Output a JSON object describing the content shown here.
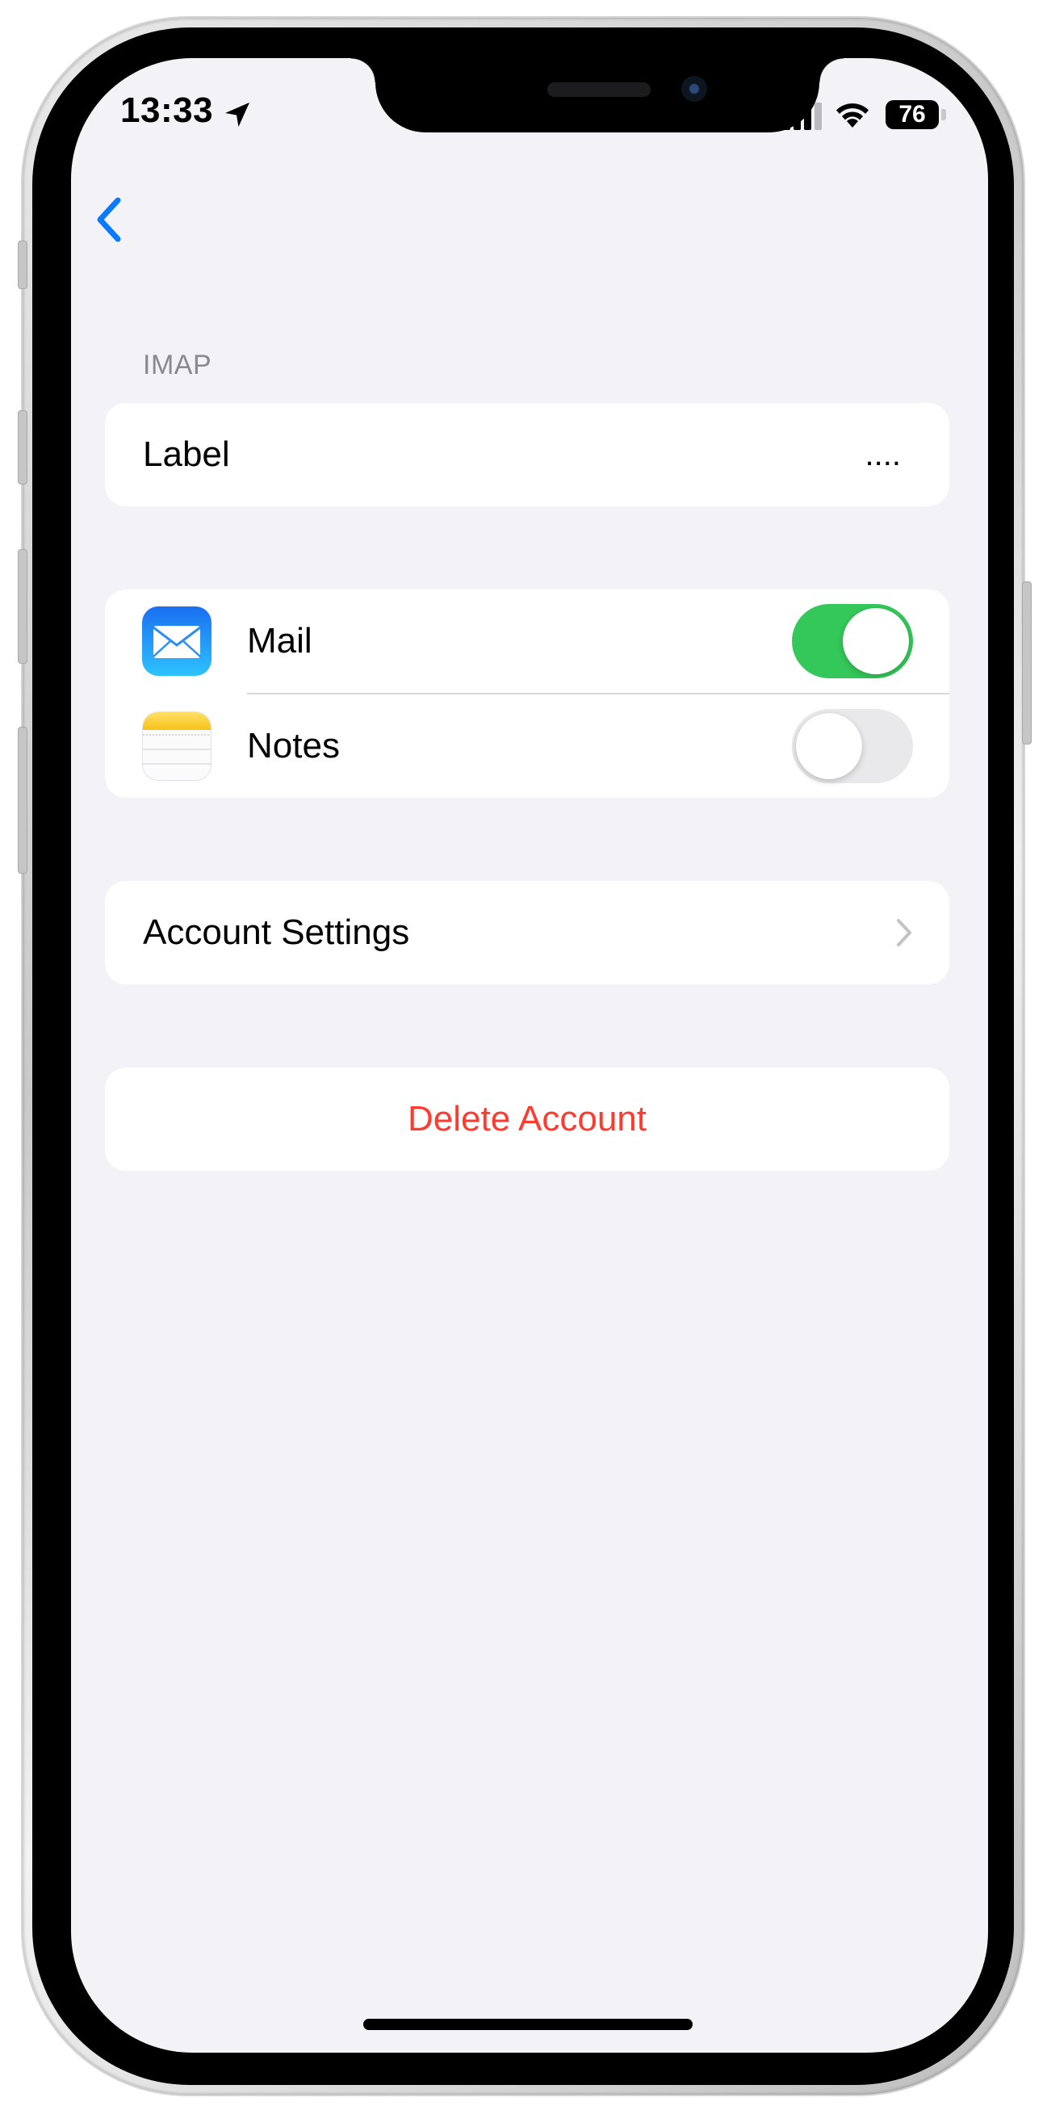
{
  "status_bar": {
    "time": "13:33",
    "battery": "76",
    "icons": [
      "location-arrow-icon",
      "cellular-signal-icon",
      "wifi-icon",
      "battery-icon"
    ]
  },
  "nav": {
    "back_icon": "chevron-left-icon"
  },
  "section_header": "IMAP",
  "label_row": {
    "label": "Label",
    "value": "...."
  },
  "apps": [
    {
      "label": "Mail",
      "icon": "mail-app-icon",
      "enabled": true
    },
    {
      "label": "Notes",
      "icon": "notes-app-icon",
      "enabled": false
    }
  ],
  "account_settings": {
    "label": "Account Settings",
    "icon": "chevron-right-icon"
  },
  "delete_account": {
    "label": "Delete Account"
  },
  "colors": {
    "background": "#f2f2f7",
    "accent_blue": "#0a7aff",
    "toggle_on": "#34c759",
    "toggle_off": "#e9e9eb",
    "destructive": "#ff3b30",
    "secondary_text": "#8a8a8e"
  }
}
